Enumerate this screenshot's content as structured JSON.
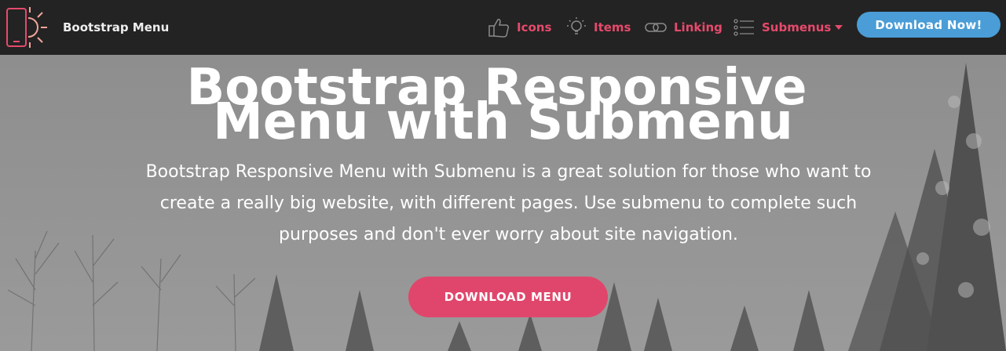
{
  "navbar": {
    "brand_name": "Bootstrap Menu",
    "items": [
      {
        "label": "Icons",
        "icon": "thumbs-up-icon"
      },
      {
        "label": "Items",
        "icon": "lightbulb-icon"
      },
      {
        "label": "Linking",
        "icon": "link-icon"
      },
      {
        "label": "Submenus",
        "icon": "list-icon"
      }
    ],
    "cta_label": "Download Now!"
  },
  "hero": {
    "title_line1": "Bootstrap Responsive",
    "title_line2": "Menu with Submenu",
    "description": "Bootstrap Responsive Menu with Submenu is a great solution for those who want to create a really big website, with different pages. Use submenu to complete such purposes and don't ever worry about site navigation.",
    "button_label": "DOWNLOAD MENU"
  },
  "colors": {
    "navbar_bg": "#232323",
    "accent": "#e74a6c",
    "cta_blue": "#4a9dd6",
    "hero_button": "#e0466b"
  }
}
